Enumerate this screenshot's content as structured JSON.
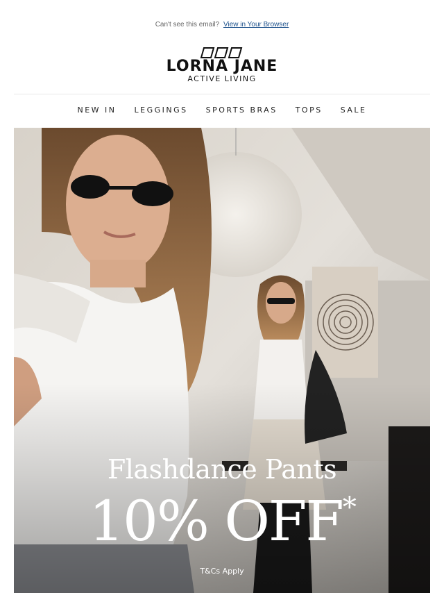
{
  "preheader": {
    "text": "Can't see this email?",
    "link_label": "View in Your Browser"
  },
  "brand": {
    "name": "LORNA JANE",
    "tagline": "ACTIVE LIVING",
    "logo_icon": "three-parallelogram-logo-mark"
  },
  "nav": {
    "items": [
      {
        "label": "NEW IN"
      },
      {
        "label": "LEGGINGS"
      },
      {
        "label": "SPORTS BRAS"
      },
      {
        "label": "TOPS"
      },
      {
        "label": "SALE"
      }
    ]
  },
  "hero": {
    "title": "Flashdance Pants",
    "offer": "10% OFF",
    "offer_mark": "*",
    "tcs_label": "T&Cs Apply"
  },
  "colors": {
    "text_dark": "#111111",
    "link": "#1a4f8a",
    "hero_overlay_text": "#ffffff"
  }
}
